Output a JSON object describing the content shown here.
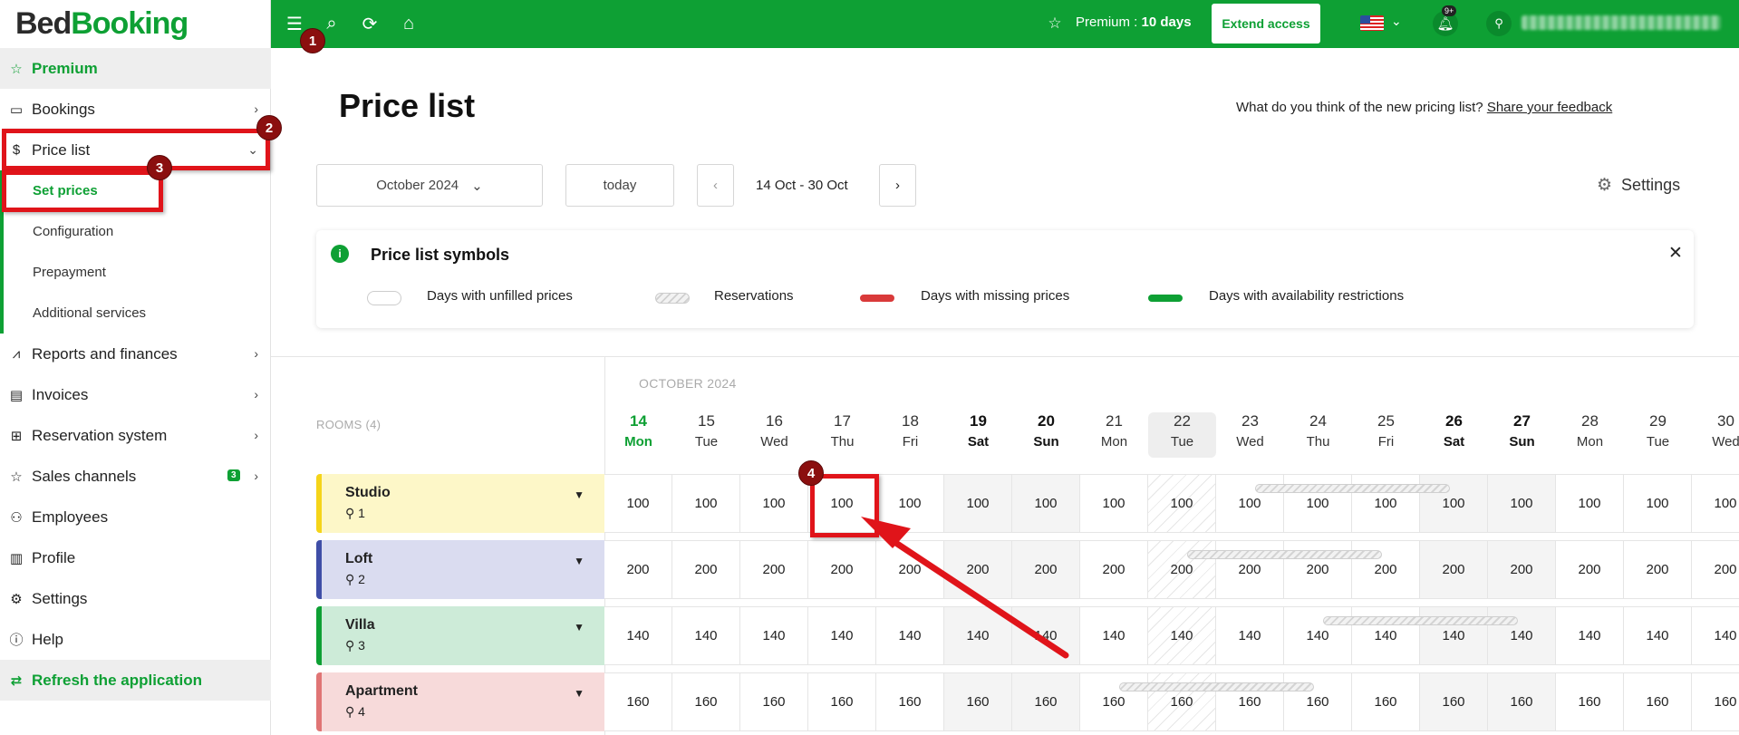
{
  "logo": {
    "part1": "Bed",
    "part2": "Booking"
  },
  "topbar": {
    "premium_label": "Premium : ",
    "premium_days": "10 days",
    "extend_label": "Extend access",
    "notif_badge": "9+"
  },
  "sidebar": {
    "items": [
      {
        "label": "Premium",
        "icon": "star-icon"
      },
      {
        "label": "Bookings",
        "icon": "calendar-icon"
      },
      {
        "label": "Price list",
        "icon": "dollar-icon"
      },
      {
        "label": "Reports and finances",
        "icon": "chart-icon"
      },
      {
        "label": "Invoices",
        "icon": "invoice-icon"
      },
      {
        "label": "Reservation system",
        "icon": "grid-icon"
      },
      {
        "label": "Sales channels",
        "icon": "star-outline-icon",
        "badge": "3"
      },
      {
        "label": "Employees",
        "icon": "add-user-icon"
      },
      {
        "label": "Profile",
        "icon": "building-icon"
      },
      {
        "label": "Settings",
        "icon": "gear-icon"
      },
      {
        "label": "Help",
        "icon": "info-icon"
      },
      {
        "label": "Refresh the application",
        "icon": "refresh-icon"
      }
    ],
    "subitems": [
      {
        "label": "Set prices"
      },
      {
        "label": "Configuration"
      },
      {
        "label": "Prepayment"
      },
      {
        "label": "Additional services"
      }
    ]
  },
  "main": {
    "title": "Price list",
    "feedback_text": "What do you think of the new pricing list? ",
    "feedback_link": "Share your feedback",
    "month_select": "October 2024",
    "today_label": "today",
    "range_label": "14 Oct - 30 Oct",
    "settings_label": "Settings"
  },
  "symbols": {
    "title": "Price list symbols",
    "entries": [
      {
        "label": "Days with unfilled prices"
      },
      {
        "label": "Reservations"
      },
      {
        "label": "Days with missing prices",
        "color": "#d93a3a"
      },
      {
        "label": "Days with availability restrictions",
        "color": "#0ea034"
      }
    ]
  },
  "calendar": {
    "month_label": "OCTOBER 2024",
    "rooms_label": "ROOMS (4)",
    "days": [
      {
        "num": "14",
        "wd": "Mon",
        "today": true
      },
      {
        "num": "15",
        "wd": "Tue"
      },
      {
        "num": "16",
        "wd": "Wed"
      },
      {
        "num": "17",
        "wd": "Thu"
      },
      {
        "num": "18",
        "wd": "Fri"
      },
      {
        "num": "19",
        "wd": "Sat",
        "weekend": true
      },
      {
        "num": "20",
        "wd": "Sun",
        "weekend": true
      },
      {
        "num": "21",
        "wd": "Mon"
      },
      {
        "num": "22",
        "wd": "Tue",
        "highlight": true
      },
      {
        "num": "23",
        "wd": "Wed"
      },
      {
        "num": "24",
        "wd": "Thu"
      },
      {
        "num": "25",
        "wd": "Fri"
      },
      {
        "num": "26",
        "wd": "Sat",
        "weekend": true
      },
      {
        "num": "27",
        "wd": "Sun",
        "weekend": true
      },
      {
        "num": "28",
        "wd": "Mon"
      },
      {
        "num": "29",
        "wd": "Tue"
      },
      {
        "num": "30",
        "wd": "Wed"
      }
    ],
    "rooms": [
      {
        "name": "Studio",
        "capacity": "1",
        "color": "#f5d419",
        "bg": "#fdf7c8",
        "price": "100"
      },
      {
        "name": "Loft",
        "capacity": "2",
        "color": "#3f4ea7",
        "bg": "#dadcf0",
        "price": "200"
      },
      {
        "name": "Villa",
        "capacity": "3",
        "color": "#0ea034",
        "bg": "#cdebd8",
        "price": "140"
      },
      {
        "name": "Apartment",
        "capacity": "4",
        "color": "#e07575",
        "bg": "#f7dada",
        "price": "160"
      }
    ]
  },
  "annotations": [
    "1",
    "2",
    "3",
    "4"
  ]
}
